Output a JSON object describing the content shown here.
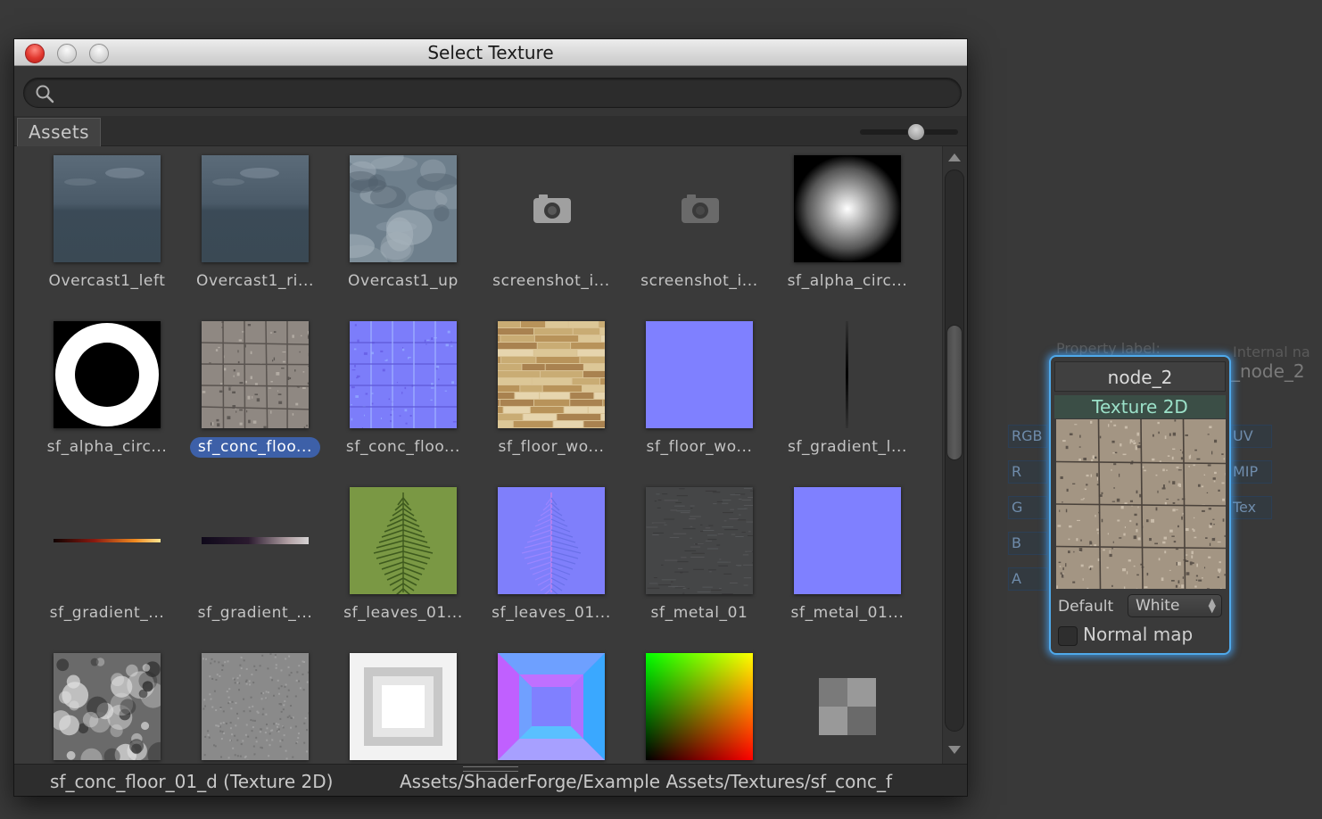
{
  "window": {
    "title": "Select Texture"
  },
  "search": {
    "placeholder": "",
    "value": ""
  },
  "tab": {
    "label": "Assets"
  },
  "slider": {
    "value": 0.6
  },
  "items": [
    {
      "label": "Overcast1_left",
      "kind": "sky-left"
    },
    {
      "label": "Overcast1_ri...",
      "kind": "sky-right"
    },
    {
      "label": "Overcast1_up",
      "kind": "sky-up"
    },
    {
      "label": "screenshot_i...",
      "kind": "camera"
    },
    {
      "label": "screenshot_i...",
      "kind": "camera-dim"
    },
    {
      "label": "sf_alpha_circ...",
      "kind": "radial"
    },
    {
      "label": "sf_alpha_circ...",
      "kind": "ring"
    },
    {
      "label": "sf_conc_floo...",
      "kind": "concrete",
      "selected": true
    },
    {
      "label": "sf_conc_floo...",
      "kind": "normal-tiles"
    },
    {
      "label": "sf_floor_wo...",
      "kind": "wood"
    },
    {
      "label": "sf_floor_wo...",
      "kind": "flat-normal"
    },
    {
      "label": "sf_gradient_l...",
      "kind": "vline"
    },
    {
      "label": "sf_gradient_...",
      "kind": "grad-fire"
    },
    {
      "label": "sf_gradient_...",
      "kind": "grad-dark"
    },
    {
      "label": "sf_leaves_01...",
      "kind": "leaves"
    },
    {
      "label": "sf_leaves_01...",
      "kind": "leaves-normal"
    },
    {
      "label": "sf_metal_01",
      "kind": "metal"
    },
    {
      "label": "sf_metal_01...",
      "kind": "flat-normal"
    },
    {
      "label": "",
      "kind": "clouds"
    },
    {
      "label": "",
      "kind": "noise"
    },
    {
      "label": "",
      "kind": "bevel-white"
    },
    {
      "label": "",
      "kind": "bevel-normal"
    },
    {
      "label": "",
      "kind": "uv-gradient"
    },
    {
      "label": "",
      "kind": "checker"
    }
  ],
  "status": {
    "selected_name": "sf_conc_floor_01_d (Texture 2D)",
    "path": "Assets/ShaderForge/Example Assets/Textures/sf_conc_f"
  },
  "node": {
    "property_label_caption": "Property label:",
    "internal_name_caption": "Internal na",
    "internal_name_value": "_node_2",
    "name": "node_2",
    "type": "Texture 2D",
    "default_label": "Default",
    "default_value": "White",
    "normal_map_label": "Normal map",
    "normal_map_checked": false,
    "inputs": [
      "RGB",
      "R",
      "G",
      "B",
      "A"
    ],
    "outputs": [
      "UV",
      "MIP",
      "Tex"
    ]
  },
  "colors": {
    "selection": "#3d60a8",
    "node_glow": "#4fa9ea",
    "node_type_text": "#9be0c8"
  }
}
